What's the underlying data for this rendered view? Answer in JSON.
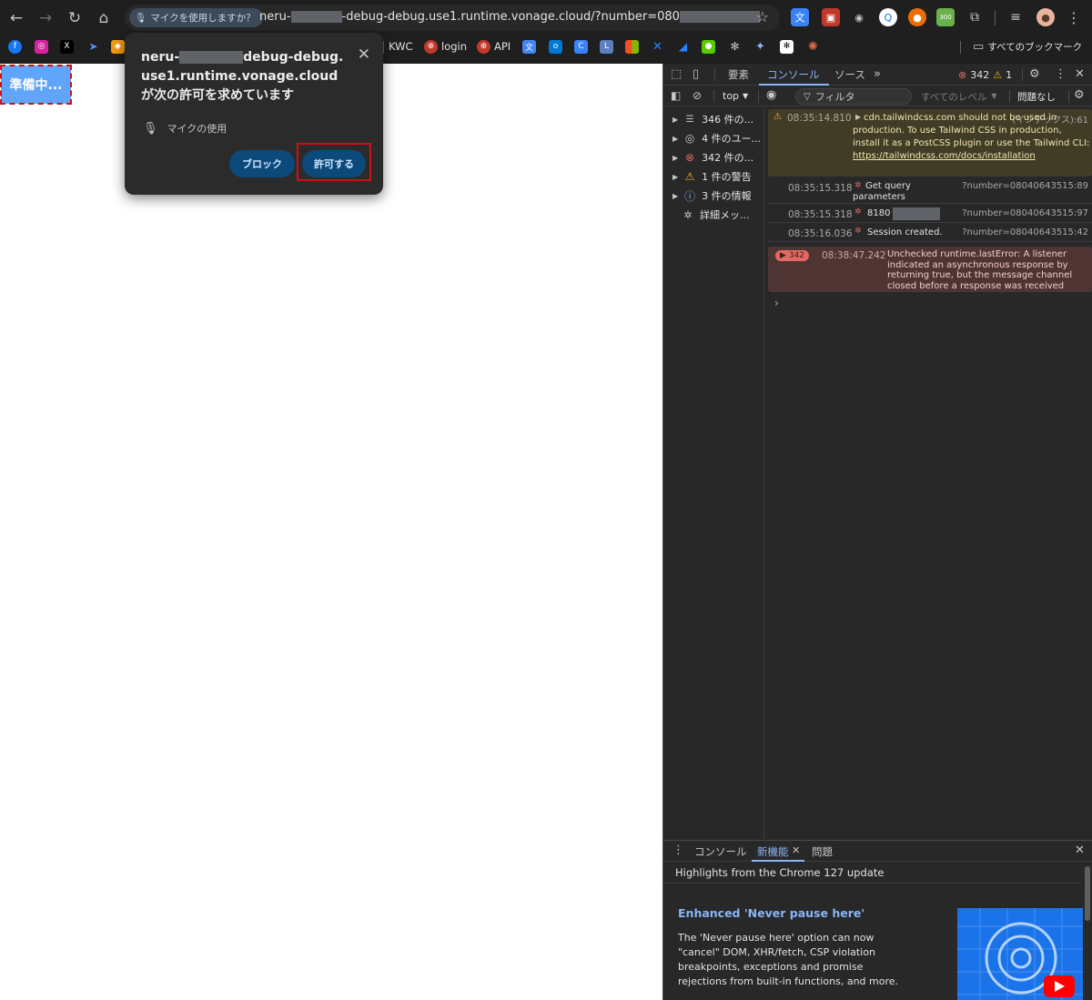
{
  "browser": {
    "permission_chip": "マイクを使用しますか？",
    "url_prefix": "neru-",
    "url_suffix": "-debug-debug.use1.runtime.vonage.cloud/?number=080",
    "bookmarks": [
      {
        "label": "KWC"
      },
      {
        "label": "login"
      },
      {
        "label": "API"
      }
    ],
    "all_bookmarks_label": "すべてのブックマーク"
  },
  "page": {
    "preparing_button": "準備中..."
  },
  "permission_popup": {
    "title_part1": "neru-",
    "title_part2": "debug-debug.use1.runtime.vonage.cloud が次の許可を求めています",
    "permission_label": "マイクの使用",
    "block_button": "ブロック",
    "allow_button": "許可する"
  },
  "devtools": {
    "tabs": {
      "elements": "要素",
      "console": "コンソール",
      "sources": "ソース"
    },
    "error_count": "342",
    "warning_count": "1",
    "toolbar": {
      "context": "top",
      "filter_placeholder": "フィルタ",
      "levels": "すべてのレベル",
      "issues": "問題なし"
    },
    "sidebar": [
      {
        "label": "346 件の...",
        "icon": "list-icon"
      },
      {
        "label": "4 件のユー...",
        "icon": "user-icon"
      },
      {
        "label": "342 件の...",
        "icon": "error-icon",
        "color": "#e46962"
      },
      {
        "label": "1 件の警告",
        "icon": "warning-icon",
        "color": "#f9a825"
      },
      {
        "label": "3 件の情報",
        "icon": "info-icon",
        "color": "#8ab4f8"
      },
      {
        "label": "詳細メッ...",
        "icon": "bug-icon"
      }
    ],
    "messages": {
      "warn": {
        "time": "08:35:14.810",
        "text": "cdn.tailwindcss.com should not be used in production. To use Tailwind CSS in production, install it as a PostCSS plugin or use the Tailwind CLI:",
        "link": "https://tailwindcss.com/docs/installation",
        "source": "(インデックス):61"
      },
      "log1": {
        "time": "08:35:15.318",
        "text": "Get query parameters",
        "source": "?number=08040643515:89"
      },
      "log2": {
        "time": "08:35:15.318",
        "text": "8180",
        "source": "?number=08040643515:97"
      },
      "log3": {
        "time": "08:35:16.036",
        "text": "Session created.",
        "source": "?number=08040643515:42"
      },
      "error": {
        "count": "342",
        "time": "08:38:47.242",
        "text": "Unchecked runtime.lastError: A listener indicated an asynchronous response by returning true, but the message channel closed before a response was received"
      }
    },
    "drawer": {
      "tabs": {
        "console": "コンソール",
        "whats_new": "新機能",
        "issues": "問題"
      },
      "highlight": "Highlights from the Chrome 127 update",
      "feature_title": "Enhanced 'Never pause here'",
      "feature_body": "The 'Never pause here' option can now \"cancel\" DOM, XHR/fetch, CSP violation breakpoints, exceptions and promise rejections from built-in functions, and more."
    }
  }
}
